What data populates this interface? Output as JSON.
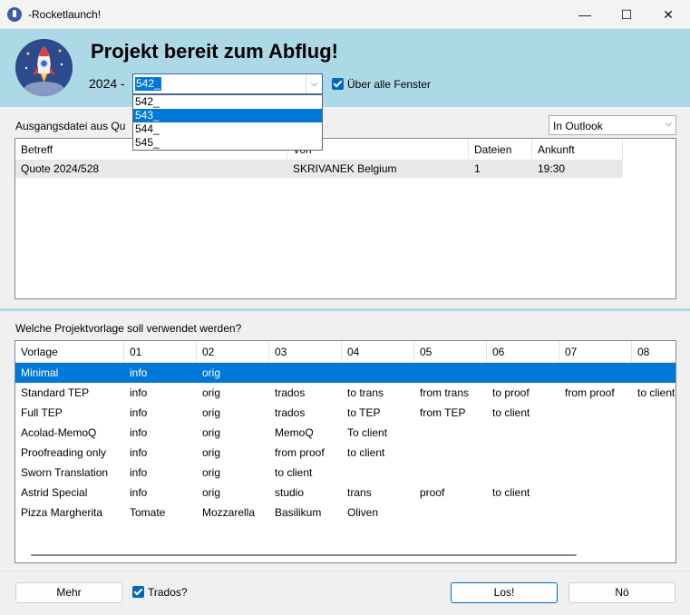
{
  "window": {
    "title": "-Rocketlaunch!",
    "minimize": "—",
    "maximize": "☐",
    "close": "✕"
  },
  "header": {
    "headline": "Projekt bereit zum Abflug!",
    "year_label": "2024 -",
    "project_combo": {
      "value": "542_",
      "options": [
        "542_",
        "543_",
        "544_",
        "545_"
      ],
      "selected_index": 1
    },
    "topmost_checkbox": {
      "label": "Über alle Fenster",
      "checked": true
    }
  },
  "source": {
    "label": "Ausgangsdatei aus Qu",
    "location_select": "In Outlook",
    "columns": [
      "Betreff",
      "Von",
      "Dateien",
      "Ankunft"
    ],
    "rows": [
      {
        "subject": "Quote 2024/528",
        "from": "SKRIVANEK Belgium",
        "files": "1",
        "arrival": "19:30"
      }
    ]
  },
  "templates": {
    "label": "Welche Projektvorlage soll verwendet werden?",
    "columns": [
      "Vorlage",
      "01",
      "02",
      "03",
      "04",
      "05",
      "06",
      "07",
      "08"
    ],
    "rows": [
      [
        "Minimal",
        "info",
        "orig",
        "",
        "",
        "",
        "",
        "",
        ""
      ],
      [
        "Standard TEP",
        "info",
        "orig",
        "trados",
        "to trans",
        "from trans",
        "to proof",
        "from proof",
        "to client"
      ],
      [
        "Full TEP",
        "info",
        "orig",
        "trados",
        "to TEP",
        "from TEP",
        "to client",
        "",
        ""
      ],
      [
        "Acolad-MemoQ",
        "info",
        "orig",
        "MemoQ",
        "To client",
        "",
        "",
        "",
        ""
      ],
      [
        "Proofreading only",
        "info",
        "orig",
        "from proof",
        "to client",
        "",
        "",
        "",
        ""
      ],
      [
        "Sworn Translation",
        "info",
        "orig",
        "to client",
        "",
        "",
        "",
        "",
        ""
      ],
      [
        "Astrid Special",
        "info",
        "orig",
        "studio",
        "trans",
        "proof",
        "to client",
        "",
        ""
      ],
      [
        "Pizza Margherita",
        "Tomate",
        "Mozzarella",
        "Basilikum",
        "Oliven",
        "",
        "",
        "",
        ""
      ]
    ],
    "selected_row": 0
  },
  "footer": {
    "more_button": "Mehr",
    "trados_checkbox": {
      "label": "Trados?",
      "checked": true
    },
    "go_button": "Los!",
    "no_button": "Nö"
  },
  "colors": {
    "header_bg": "#add8e6",
    "selection": "#0078d7",
    "accent": "#0067c0"
  }
}
